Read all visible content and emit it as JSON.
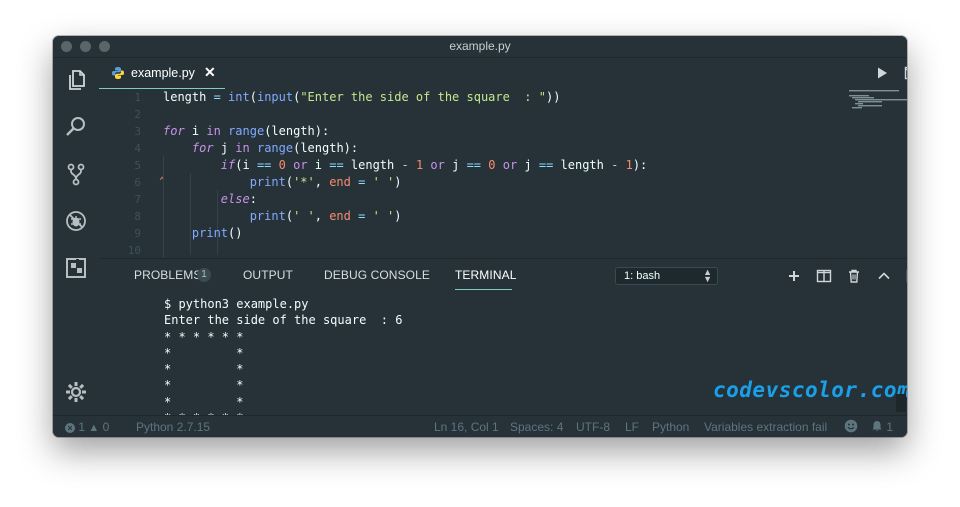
{
  "window": {
    "title": "example.py"
  },
  "tab": {
    "label": "example.py",
    "close_glyph": "✕"
  },
  "editor": {
    "line_numbers": [
      "1",
      "2",
      "3",
      "4",
      "5",
      "6",
      "7",
      "8",
      "9",
      "10"
    ]
  },
  "panel": {
    "tabs": [
      "PROBLEMS",
      "OUTPUT",
      "DEBUG CONSOLE",
      "TERMINAL"
    ],
    "active_tab": "TERMINAL",
    "problems_count": "1",
    "terminal_select": "1: bash"
  },
  "terminal": {
    "lines": [
      "$ python3 example.py",
      "Enter the side of the square  : 6",
      "* * * * * *",
      "*         *",
      "*         *",
      "*         *",
      "*         *",
      "* * * * * *"
    ],
    "prompt": "$ "
  },
  "watermark": "codevscolor.com",
  "statusbar": {
    "errors": "1",
    "warnings": "0",
    "interpreter": "Python 2.7.15",
    "position": "Ln 16, Col 1",
    "spaces": "Spaces: 4",
    "encoding": "UTF-8",
    "eol": "LF",
    "language": "Python",
    "message": "Variables extraction fail",
    "notifications": "1"
  },
  "colors": {
    "background": "#263238",
    "accent": "#80cbc4",
    "keyword": "#c792ea",
    "function": "#82aaff",
    "string": "#c3e88d",
    "number": "#f78c6c",
    "watermark": "#1aa0e8"
  },
  "icons": [
    "files-icon",
    "search-icon",
    "source-control-icon",
    "debug-icon",
    "extensions-icon",
    "gear-icon",
    "python-file-icon",
    "run-icon",
    "split-editor-icon",
    "more-actions-icon",
    "add-terminal-icon",
    "split-terminal-icon",
    "trash-icon",
    "chevron-up-icon",
    "toggle-panel-icon",
    "close-icon",
    "error-icon",
    "warning-icon",
    "smiley-icon",
    "bell-icon"
  ]
}
